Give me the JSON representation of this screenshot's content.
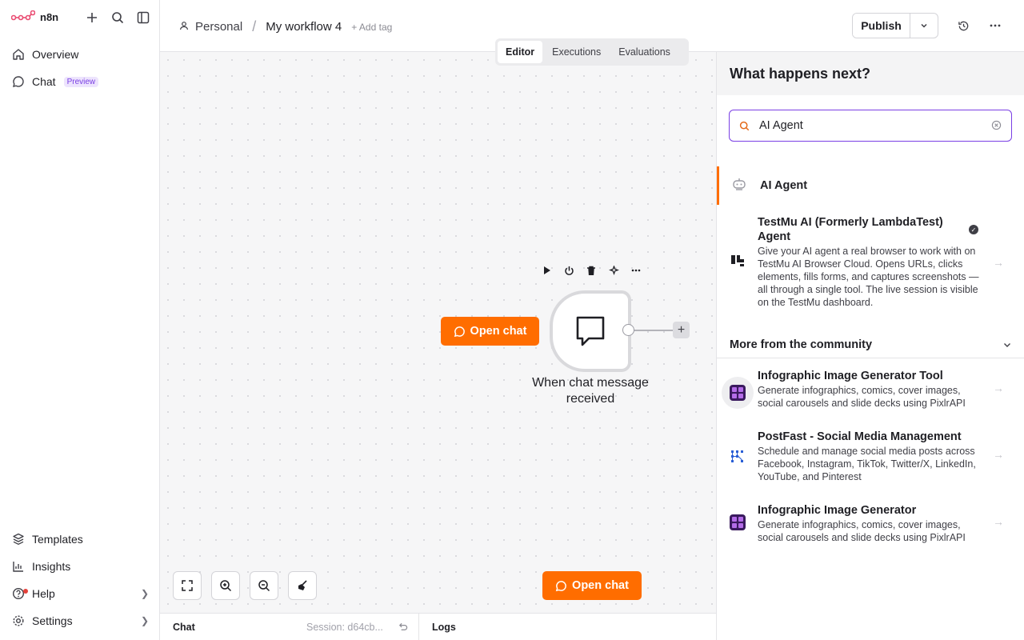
{
  "app": {
    "logo_text": "n8n"
  },
  "sidebar": {
    "top": [
      {
        "label": "Overview"
      },
      {
        "label": "Chat",
        "badge": "Preview"
      }
    ],
    "bottom": [
      {
        "label": "Templates"
      },
      {
        "label": "Insights"
      },
      {
        "label": "Help"
      },
      {
        "label": "Settings"
      }
    ]
  },
  "header": {
    "project": "Personal",
    "workflow_name": "My workflow 4",
    "add_tag": "+ Add tag",
    "publish_label": "Publish"
  },
  "tabs": [
    {
      "label": "Editor",
      "active": true
    },
    {
      "label": "Executions",
      "active": false
    },
    {
      "label": "Evaluations",
      "active": false
    }
  ],
  "canvas": {
    "open_chat_label": "Open chat",
    "trigger_node_label": "When chat message received"
  },
  "bottom_bar": {
    "chat_label": "Chat",
    "session_text": "Session: d64cb...",
    "logs_label": "Logs"
  },
  "panel": {
    "title": "What happens next?",
    "search_value": "AI Agent",
    "results": [
      {
        "name": "AI Agent"
      },
      {
        "name": "TestMu AI (Formerly LambdaTest) Agent",
        "description": "Give your AI agent a real browser to work with on TestMu AI Browser Cloud. Opens URLs, clicks elements, fills forms, and captures screenshots — all through a single tool. The live session is visible on the TestMu dashboard."
      }
    ],
    "community_title": "More from the community",
    "community": [
      {
        "name": "Infographic Image Generator Tool",
        "description": "Generate infographics, comics, cover images, social carousels and slide decks using PixlrAPI"
      },
      {
        "name": "PostFast - Social Media Management",
        "description": "Schedule and manage social media posts across Facebook, Instagram, TikTok, Twitter/X, LinkedIn, YouTube, and Pinterest"
      },
      {
        "name": "Infographic Image Generator",
        "description": "Generate infographics, comics, cover images, social carousels and slide decks using PixlrAPI"
      }
    ]
  },
  "colors": {
    "accent_orange": "#ff6d00",
    "accent_purple": "#7a3fe4"
  }
}
